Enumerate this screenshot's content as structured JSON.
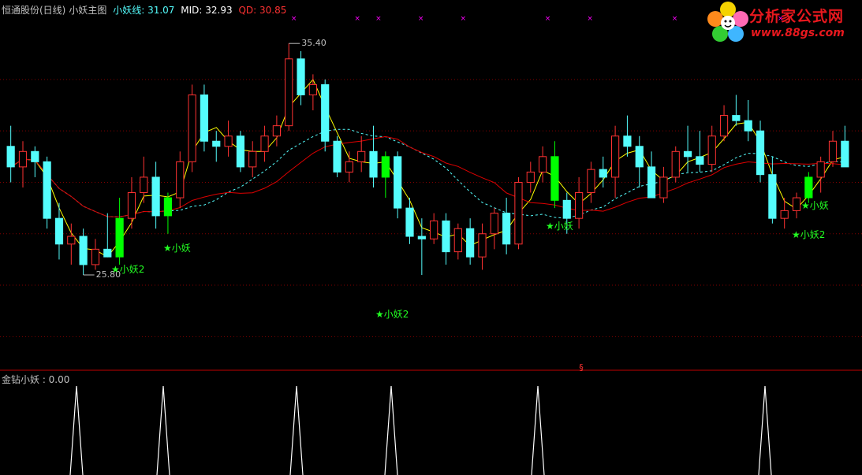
{
  "header": {
    "stock": "恒通股份(日线)",
    "indicator": "小妖主图",
    "line1_label": "小妖线: 31.07",
    "line2_label": "MID: 32.93",
    "line3_label": "QD: 30.85"
  },
  "sub_header": {
    "label": "金钻小妖 : 0.00"
  },
  "logo": {
    "title": "分析家公式网",
    "url": "www.88gs.com"
  },
  "markers": {
    "high": "35.40",
    "low": "25.80",
    "split": "§"
  },
  "signals": [
    {
      "text": "★小妖2",
      "idx": 9
    },
    {
      "text": "★小妖",
      "idx": 13
    },
    {
      "text": "★小妖2",
      "idx": 31
    },
    {
      "text": "★小妖",
      "idx": 45
    },
    {
      "text": "★小妖",
      "idx": 67
    },
    {
      "text": "★小妖2",
      "idx": 66
    }
  ],
  "colors": {
    "up": "#ff3232",
    "down": "#54fcfc",
    "signal": "#00ff00",
    "mid": "#e00000",
    "qd": "#54fcfc",
    "fast": "#ffff00",
    "grid": "#800000",
    "cross": "#ff00ff",
    "spike": "#ffffff"
  },
  "chart_data": [
    {
      "type": "candlestick",
      "title": "",
      "ylim": [
        23.0,
        36.6
      ],
      "gridlines": [
        34.0,
        32.0,
        30.0,
        28.0,
        26.0,
        24.0
      ],
      "ohlc": [
        [
          31.4,
          32.2,
          30.0,
          30.6
        ],
        [
          30.6,
          31.6,
          29.8,
          31.2
        ],
        [
          31.2,
          31.4,
          30.2,
          30.8
        ],
        [
          30.8,
          31.0,
          28.2,
          28.6
        ],
        [
          28.6,
          29.2,
          27.0,
          27.6
        ],
        [
          27.6,
          28.4,
          26.8,
          27.9
        ],
        [
          27.9,
          28.2,
          26.4,
          26.8
        ],
        [
          26.8,
          27.8,
          26.6,
          27.4
        ],
        [
          27.4,
          28.8,
          27.2,
          27.1
        ],
        [
          27.1,
          29.4,
          26.8,
          28.6
        ],
        [
          28.6,
          30.2,
          28.2,
          29.6
        ],
        [
          29.6,
          31.0,
          29.2,
          30.2
        ],
        [
          30.2,
          30.8,
          28.2,
          28.7
        ],
        [
          28.7,
          29.6,
          28.0,
          29.4
        ],
        [
          29.4,
          31.2,
          29.0,
          30.8
        ],
        [
          30.8,
          33.8,
          30.4,
          33.4
        ],
        [
          33.4,
          33.8,
          31.2,
          31.6
        ],
        [
          31.6,
          32.0,
          30.8,
          31.4
        ],
        [
          31.4,
          32.4,
          31.0,
          31.8
        ],
        [
          31.8,
          32.0,
          30.4,
          30.6
        ],
        [
          30.6,
          31.6,
          30.2,
          31.2
        ],
        [
          31.2,
          32.2,
          30.8,
          31.8
        ],
        [
          31.8,
          32.6,
          31.4,
          32.2
        ],
        [
          32.2,
          35.4,
          32.0,
          34.8
        ],
        [
          34.8,
          35.1,
          33.0,
          33.4
        ],
        [
          33.4,
          34.2,
          32.8,
          33.8
        ],
        [
          33.8,
          34.0,
          31.2,
          31.6
        ],
        [
          31.6,
          31.8,
          30.2,
          30.4
        ],
        [
          30.4,
          31.2,
          30.0,
          30.8
        ],
        [
          30.8,
          31.8,
          30.4,
          31.2
        ],
        [
          31.2,
          32.2,
          29.8,
          30.2
        ],
        [
          30.2,
          31.2,
          29.4,
          31.0
        ],
        [
          31.0,
          31.2,
          28.6,
          29.0
        ],
        [
          29.0,
          29.4,
          27.6,
          27.9
        ],
        [
          27.9,
          28.6,
          26.4,
          27.8
        ],
        [
          27.8,
          28.8,
          27.6,
          28.5
        ],
        [
          28.5,
          28.8,
          26.8,
          27.3
        ],
        [
          27.3,
          28.4,
          27.0,
          28.2
        ],
        [
          28.2,
          28.6,
          26.8,
          27.1
        ],
        [
          27.1,
          28.4,
          26.6,
          28.0
        ],
        [
          28.0,
          29.0,
          27.4,
          28.8
        ],
        [
          28.8,
          29.4,
          27.2,
          27.6
        ],
        [
          27.6,
          30.2,
          27.4,
          30.0
        ],
        [
          30.0,
          30.8,
          29.6,
          30.4
        ],
        [
          30.4,
          31.4,
          30.0,
          31.0
        ],
        [
          31.0,
          31.6,
          29.0,
          29.3
        ],
        [
          29.3,
          29.6,
          28.0,
          28.6
        ],
        [
          28.6,
          30.2,
          28.2,
          29.6
        ],
        [
          29.6,
          30.8,
          29.2,
          30.5
        ],
        [
          30.5,
          31.0,
          29.8,
          30.2
        ],
        [
          30.2,
          32.2,
          29.4,
          31.8
        ],
        [
          31.8,
          32.6,
          31.0,
          31.4
        ],
        [
          31.4,
          31.8,
          29.8,
          30.6
        ],
        [
          30.6,
          31.2,
          29.6,
          29.4
        ],
        [
          29.4,
          30.6,
          29.2,
          30.2
        ],
        [
          30.2,
          31.4,
          30.0,
          31.2
        ],
        [
          31.2,
          32.2,
          30.4,
          31.0
        ],
        [
          31.0,
          32.0,
          30.4,
          30.7
        ],
        [
          30.7,
          32.2,
          30.4,
          31.8
        ],
        [
          31.8,
          33.0,
          31.6,
          32.6
        ],
        [
          32.6,
          33.4,
          32.2,
          32.4
        ],
        [
          32.4,
          33.2,
          31.6,
          32.0
        ],
        [
          32.0,
          32.4,
          30.0,
          30.3
        ],
        [
          30.3,
          31.0,
          28.4,
          28.6
        ],
        [
          28.6,
          29.4,
          28.2,
          28.9
        ],
        [
          28.9,
          29.6,
          28.6,
          29.4
        ],
        [
          29.4,
          30.4,
          29.2,
          30.2
        ],
        [
          30.2,
          31.0,
          29.6,
          30.8
        ],
        [
          30.8,
          32.0,
          30.6,
          31.6
        ],
        [
          31.6,
          32.2,
          30.8,
          30.6
        ]
      ],
      "spikes": [
        8,
        10,
        14,
        17,
        27,
        42,
        60
      ],
      "subchart_ylim": [
        0,
        1
      ]
    }
  ]
}
